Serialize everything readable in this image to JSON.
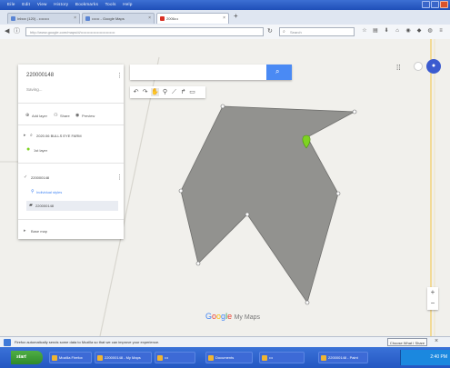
{
  "titlebar": {
    "menu": [
      "Eile",
      "Edit",
      "View",
      "History",
      "Bookmarks",
      "Tools",
      "Help"
    ]
  },
  "tabs": [
    {
      "title": "Inbox (120) - ••••••••",
      "active": false
    },
    {
      "title": "•••••• - Google Maps",
      "active": false
    },
    {
      "title": "2006•••",
      "active": true
    }
  ],
  "navbar": {
    "url": "http://www.google.com/maps/d/•••••••••••••••••••••••••••",
    "search_placeholder": "Search"
  },
  "panel": {
    "map_title": "220000148",
    "map_subtitle": "Saving...",
    "actions": [
      "Add layer",
      "Share",
      "Preview"
    ],
    "layer1_title": "2020.06 BULLS EYE FARM",
    "layer1_item": "1st layer",
    "layer2_title": "220000148",
    "layer2_style": "Individual styles",
    "layer2_item": "220000148",
    "base_map": "Base map"
  },
  "map": {
    "logo": [
      "G",
      "o",
      "o",
      "g",
      "l",
      "e"
    ],
    "logo_suffix": "My Maps",
    "polygon_fill": "#8c8c8a",
    "marker_color": "#7ed321"
  },
  "notification": {
    "text": "Firefox automatically sends some data to Mozilla so that we can improve your experience.",
    "button": "Choose What I Share"
  },
  "taskbar": {
    "start": "start",
    "tasks": [
      "Mozilla Firefox",
      "220000148 - My Maps",
      "•••",
      "Documents",
      "•••",
      "220000148 - Paint"
    ],
    "clock": "2:40 PM"
  },
  "colors": {
    "accent": "#4a8af4",
    "title_bar": "#1f4fb8",
    "taskbar": "#2457c2"
  }
}
